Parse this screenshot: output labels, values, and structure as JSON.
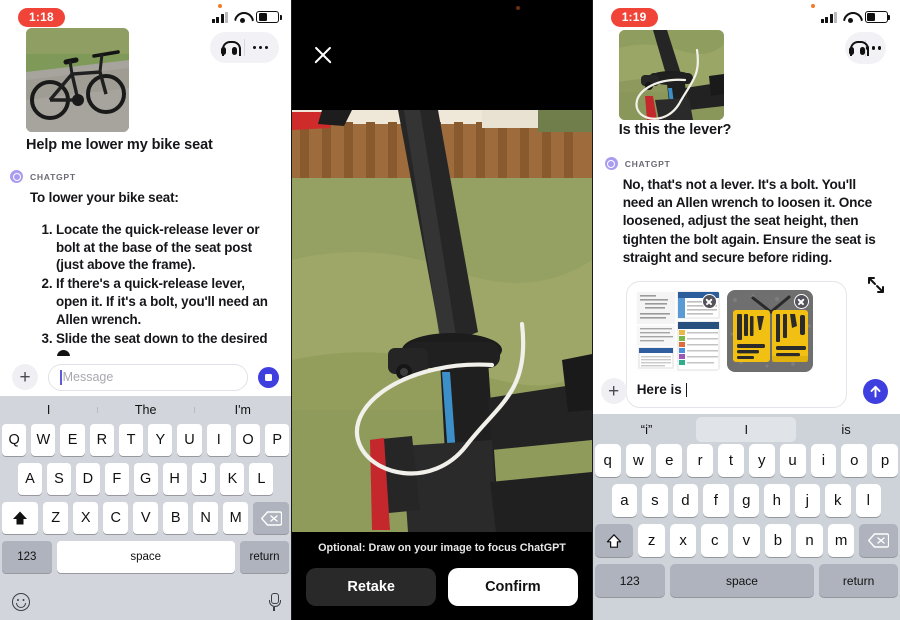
{
  "panel1": {
    "status": {
      "time": "1:18",
      "signal_icon": "cellular-signal-icon",
      "wifi_icon": "wifi-icon",
      "battery_icon": "battery-icon"
    },
    "top_actions": {
      "headphones_icon": "headphones-icon",
      "more_icon": "more-options-icon"
    },
    "user_message": {
      "image_alt": "bike-photo",
      "text": "Help me lower my bike seat"
    },
    "assistant": {
      "name": "CHATGPT",
      "intro": "To lower your bike seat:",
      "steps": [
        "Locate the quick-release lever or bolt at the base of the seat post (just above the frame).",
        "If there's a quick-release lever, open it. If it's a bolt, you'll need an Allen wrench.",
        "Slide the seat down to the desired"
      ]
    },
    "composer": {
      "plus_label": "+",
      "placeholder": "Message",
      "value": "",
      "send_icon": "stop-icon"
    },
    "keyboard": {
      "suggestions": [
        "I",
        "The",
        "I'm"
      ],
      "row1": [
        "Q",
        "W",
        "E",
        "R",
        "T",
        "Y",
        "U",
        "I",
        "O",
        "P"
      ],
      "row2": [
        "A",
        "S",
        "D",
        "F",
        "G",
        "H",
        "J",
        "K",
        "L"
      ],
      "row3": [
        "Z",
        "X",
        "C",
        "V",
        "B",
        "N",
        "M"
      ],
      "shift_icon": "shift-icon",
      "backspace_icon": "backspace-icon",
      "numbers_label": "123",
      "space_label": "space",
      "return_label": "return",
      "emoji_icon": "emoji-icon",
      "mic_icon": "microphone-icon"
    }
  },
  "panel2": {
    "close_icon": "close-icon",
    "photo_alt": "bike-seat-post-clamp-photo-with-drawn-circle",
    "hint": "Optional: Draw on your image to focus ChatGPT",
    "retake_label": "Retake",
    "confirm_label": "Confirm"
  },
  "panel3": {
    "status": {
      "time": "1:19",
      "signal_icon": "cellular-signal-icon",
      "wifi_icon": "wifi-icon",
      "battery_icon": "battery-icon"
    },
    "top_actions": {
      "headphones_icon": "headphones-icon",
      "more_icon": "more-options-icon"
    },
    "user_message": {
      "image_alt": "seat-post-clamp-photo",
      "text": "Is this the lever?"
    },
    "assistant": {
      "name": "CHATGPT",
      "text": "No, that's not a lever. It's a bolt. You'll need an Allen wrench to loosen it. Once loosened, adjust the seat height, then tighten the bolt again. Ensure the seat is straight and secure before riding."
    },
    "composer": {
      "plus_label": "+",
      "attachments": [
        {
          "name": "document-screenshot-attachment",
          "remove_icon": "remove-attachment-icon"
        },
        {
          "name": "tool-kit-photo-attachment",
          "remove_icon": "remove-attachment-icon"
        }
      ],
      "value": "Here is",
      "expand_icon": "expand-icon",
      "send_icon": "send-arrow-up-icon"
    },
    "keyboard": {
      "suggestions": [
        "“i”",
        "I",
        "is"
      ],
      "selected_suggestion_index": 1,
      "row1": [
        "q",
        "w",
        "e",
        "r",
        "t",
        "y",
        "u",
        "i",
        "o",
        "p"
      ],
      "row2": [
        "a",
        "s",
        "d",
        "f",
        "g",
        "h",
        "j",
        "k",
        "l"
      ],
      "row3": [
        "z",
        "x",
        "c",
        "v",
        "b",
        "n",
        "m"
      ],
      "shift_icon": "shift-icon",
      "backspace_icon": "backspace-icon",
      "numbers_label": "123",
      "space_label": "space",
      "return_label": "return"
    }
  },
  "colors": {
    "accent_blue": "#3f3fe0",
    "time_pill_red": "#f04438",
    "gpt_avatar": "#ab9cf0",
    "keyboard_bg": "#d2d5db"
  }
}
